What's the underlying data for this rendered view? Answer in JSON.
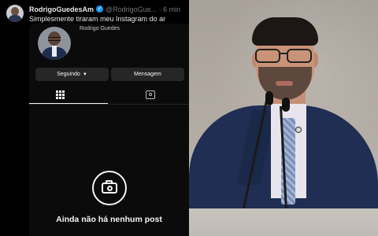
{
  "tweet": {
    "display_name": "RodrigoGuedesAm",
    "handle_time": "@RodrigoGue... · 6 min",
    "text": "Simplesmente tiraram meu Instagram do ar"
  },
  "instagram": {
    "profile_name": "Rodrigo Guedes",
    "follow_button": "Seguindo",
    "message_button": "Mensagem",
    "empty_state": "Ainda não há nenhum post"
  },
  "icons": {
    "verified": "verified-badge-icon",
    "grid": "grid-icon",
    "tagged": "tagged-person-icon",
    "camera": "camera-icon",
    "chevron": "chevron-down-icon"
  },
  "colors": {
    "background": "#000000",
    "button": "#262626",
    "verified": "#1d9bf0",
    "suit": "#1f2e52"
  }
}
